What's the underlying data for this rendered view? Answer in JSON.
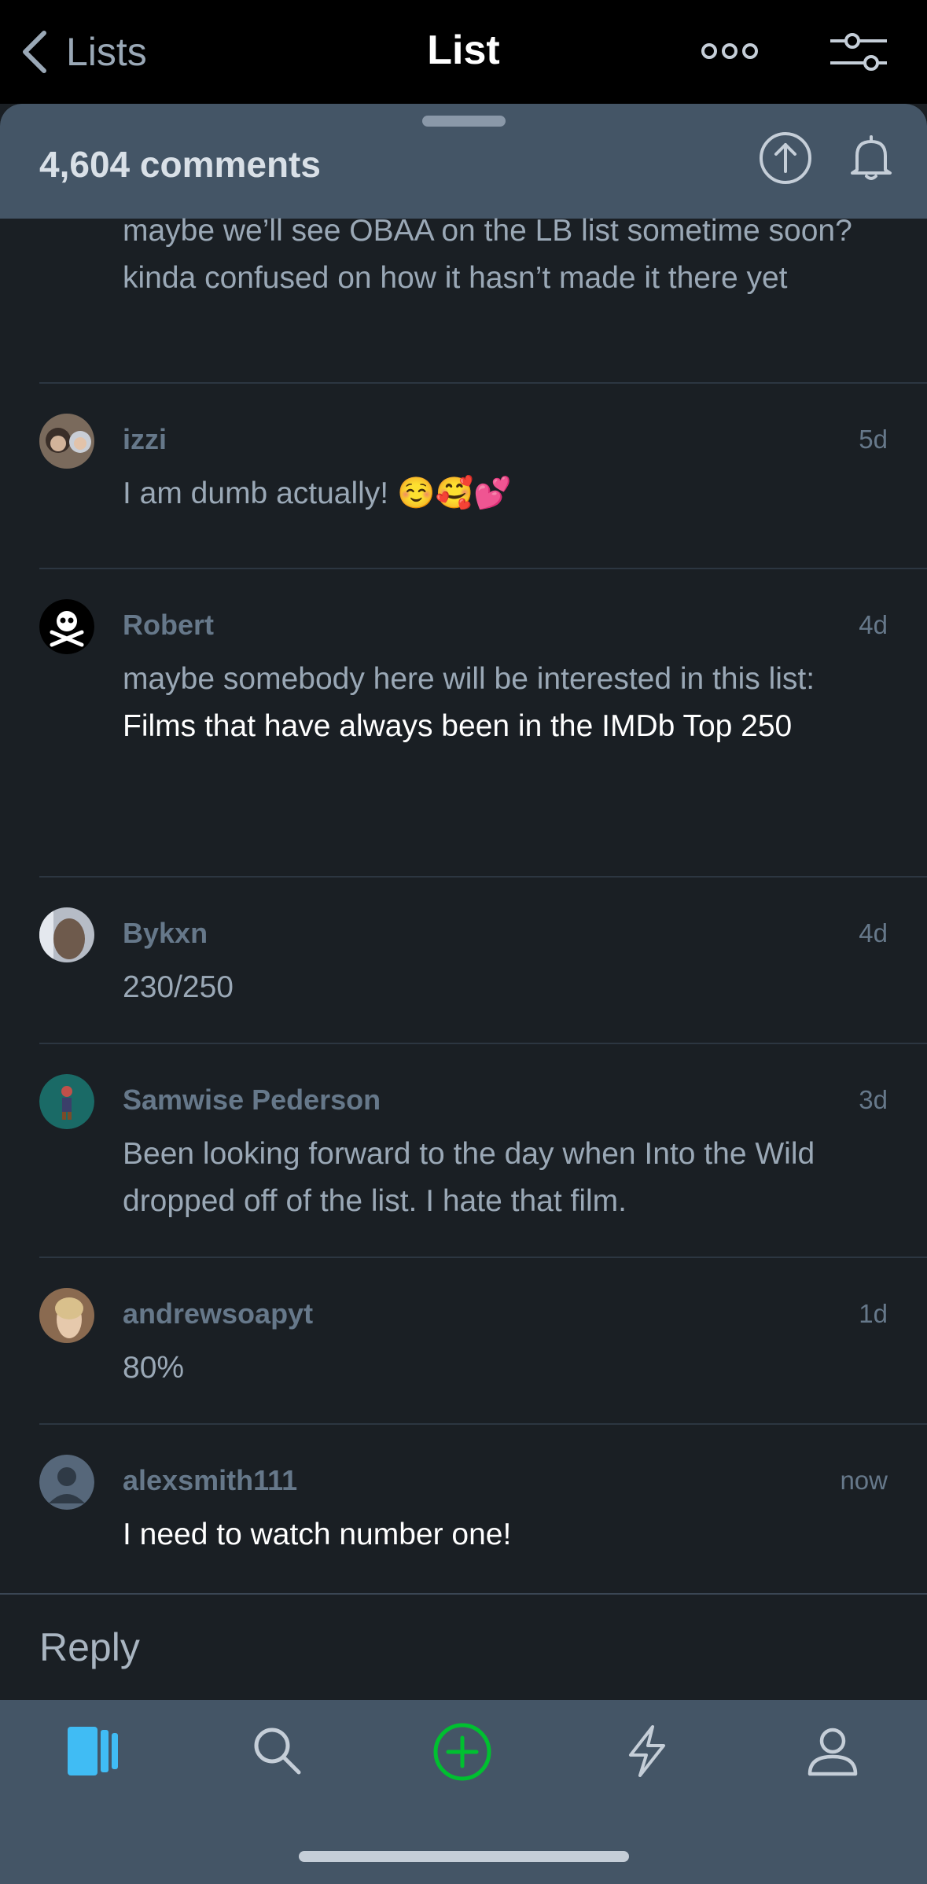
{
  "nav": {
    "back_label": "Lists",
    "title": "List"
  },
  "sheet": {
    "comment_count": "4,604 comments"
  },
  "first_comment_tail": "maybe we’ll see OBAA on the LB list sometime soon? kinda confused on how it hasn’t made it there yet",
  "comments": [
    {
      "name": "izzi",
      "time": "5d",
      "body": "I am dumb actually! ☺️🥰💕"
    },
    {
      "name": "Robert",
      "time": "4d",
      "body": "maybe somebody here will be interested in this list:",
      "link": "Films that have always been in the IMDb Top 250"
    },
    {
      "name": "Bykxn",
      "time": "4d",
      "body": "230/250"
    },
    {
      "name": "Samwise Pederson",
      "time": "3d",
      "body": "Been looking forward to the day when Into the Wild dropped off of the list. I hate that film."
    },
    {
      "name": "andrewsoapyt",
      "time": "1d",
      "body": "80%"
    },
    {
      "name": "alexsmith111",
      "time": "now",
      "body": "I need to watch number one!"
    }
  ],
  "reply": {
    "placeholder": "Reply"
  },
  "colors": {
    "accent_green": "#00c030",
    "accent_blue": "#40bcf4",
    "sheet_header": "#445566"
  },
  "icons": [
    "chevron-left-icon",
    "more-icon",
    "filter-icon",
    "scroll-top-icon",
    "bell-icon",
    "films-icon",
    "search-icon",
    "add-icon",
    "activity-icon",
    "profile-icon"
  ]
}
